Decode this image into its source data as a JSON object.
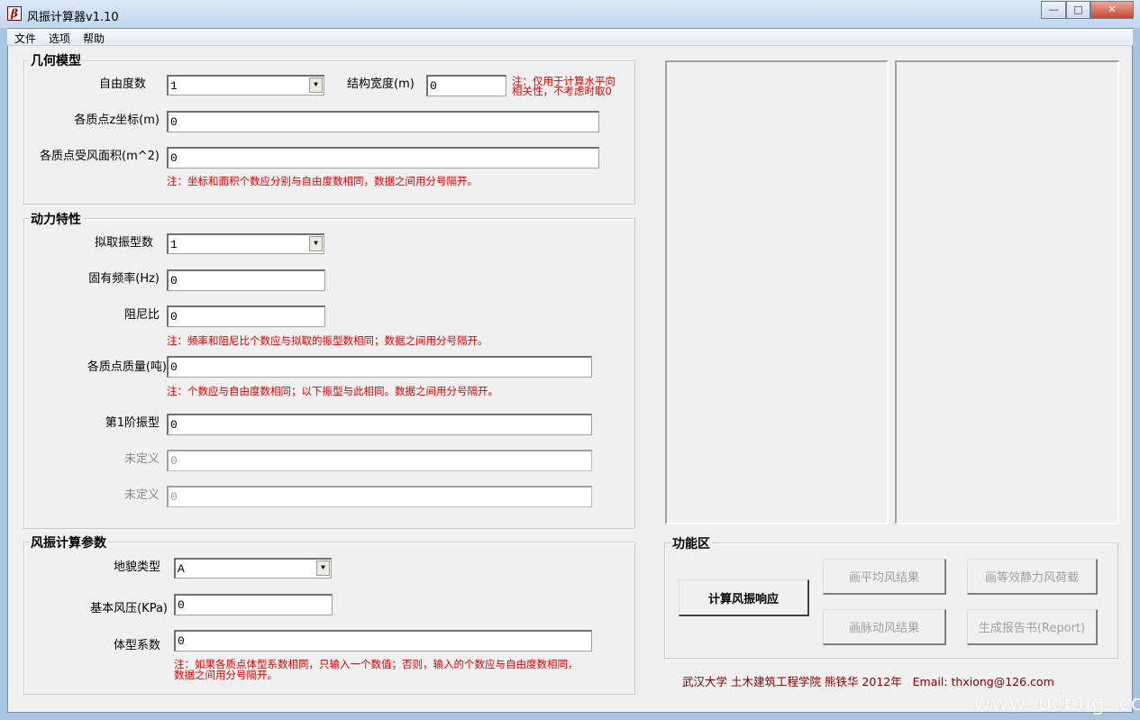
{
  "window": {
    "title": "风振计算器v1.10",
    "controls": [
      "—",
      "□",
      "✕"
    ]
  },
  "menu": [
    "文件",
    "选项",
    "帮助"
  ],
  "geometry": {
    "title": "几何模型",
    "dof_label": "自由度数",
    "dof_value": "1",
    "width_label": "结构宽度(m)",
    "width_value": "0",
    "width_note_1": "注：仅用于计算水平向",
    "width_note_2": "相关性，不考虑时取0",
    "z_label": "各质点z坐标(m)",
    "z_value": "0",
    "area_label": "各质点受风面积(m^2)",
    "area_value": "0",
    "note": "注：坐标和面积个数应分别与自由度数相同，数据之间用分号隔开。"
  },
  "dynamics": {
    "title": "动力特性",
    "modes_label": "拟取振型数",
    "modes_value": "1",
    "freq_label": "固有频率(Hz)",
    "freq_value": "0",
    "damp_label": "阻尼比",
    "damp_value": "0",
    "note1": "注：频率和阻尼比个数应与拟取的振型数相同；数据之间用分号隔开。",
    "mass_label": "各质点质量(吨)",
    "mass_value": "0",
    "note2": "注：个数应与自由度数相同；以下振型与此相同。数据之间用分号隔开。",
    "mode1_label": "第1阶振型",
    "mode1_value": "0",
    "undef_label": "未定义",
    "undef1_value": "0",
    "undef2_value": "0"
  },
  "wind": {
    "title": "风振计算参数",
    "terrain_label": "地貌类型",
    "terrain_value": "A",
    "pressure_label": "基本风压(KPa)",
    "pressure_value": "0",
    "shape_label": "体型系数",
    "shape_value": "0",
    "note_1": "注：如果各质点体型系数相同，只输入一个数值；否则，输入的个数应与自由度数相同，",
    "note_2": "数据之间用分号隔开。"
  },
  "functions": {
    "title": "功能区",
    "calc": "计算风振响应",
    "mean": "画平均风结果",
    "static": "画等效静力风荷载",
    "fluct": "画脉动风结果",
    "report": "生成报告书(Report)"
  },
  "footer": "武汉大学 土木建筑工程学院 熊铁华 2012年   Email: thxiong@126.com",
  "watermark": "www. ucbug. cc"
}
